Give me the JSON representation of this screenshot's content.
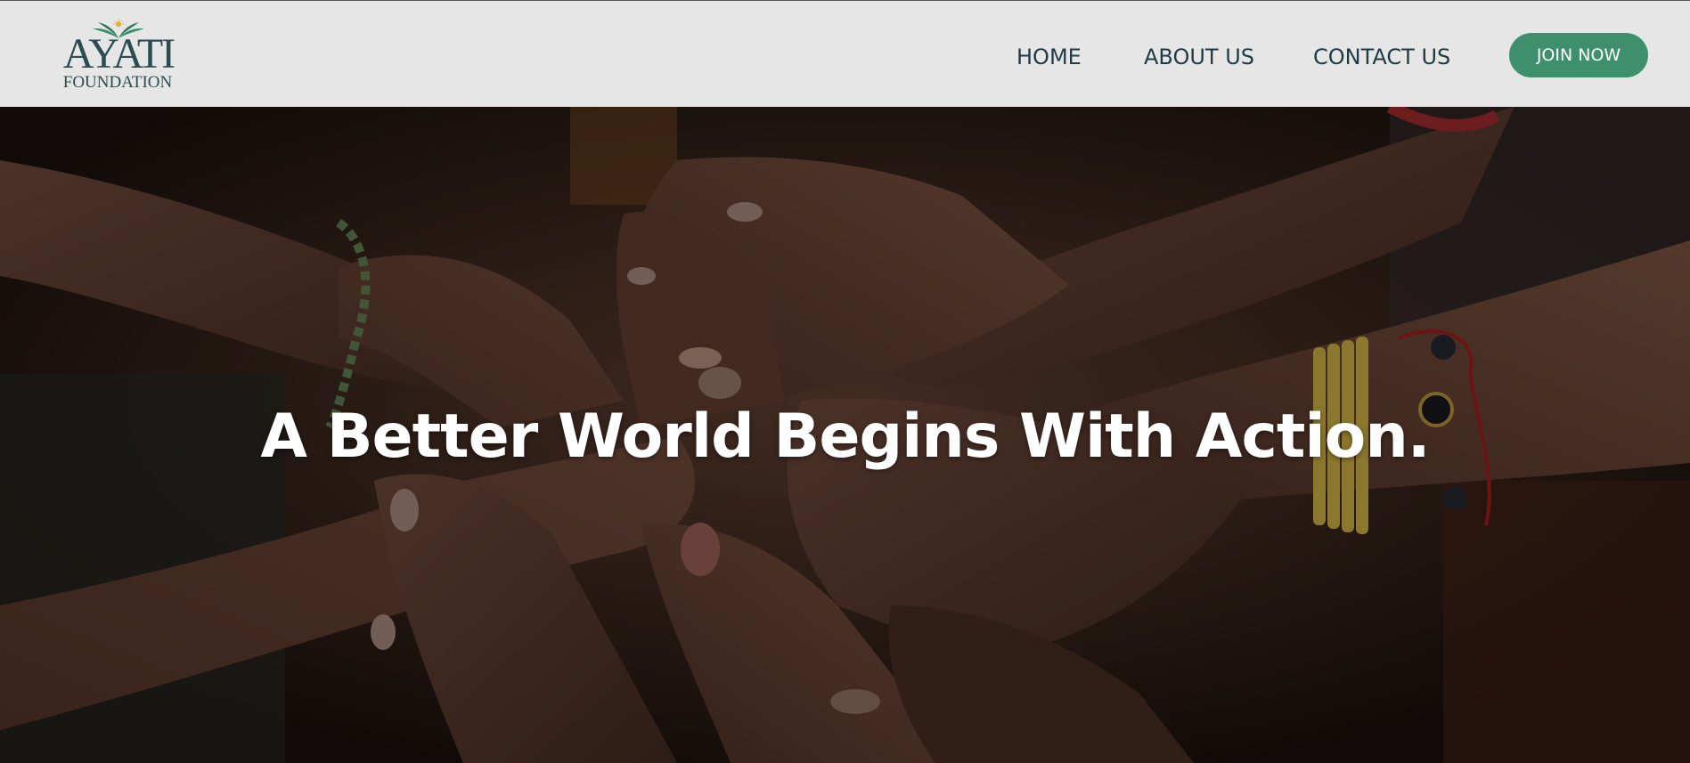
{
  "brand": {
    "name": "AYATI",
    "subtitle": "FOUNDATION",
    "mark_icon": "leaves-and-sun-icon",
    "text_color": "#2b4d52",
    "leaf_color": "#3e8f6d",
    "sun_color": "#e0b43a"
  },
  "nav": {
    "items": [
      {
        "label": "HOME"
      },
      {
        "label": "ABOUT US"
      },
      {
        "label": "CONTACT US"
      }
    ],
    "cta_label": "JOIN NOW",
    "text_color": "#1f3b46",
    "cta_color": "#3e8f6d",
    "header_bg": "#e6e6e6"
  },
  "hero": {
    "headline": "A Better World Begins With Action.",
    "background": "stacked-hands-photo",
    "text_color": "#ffffff"
  }
}
